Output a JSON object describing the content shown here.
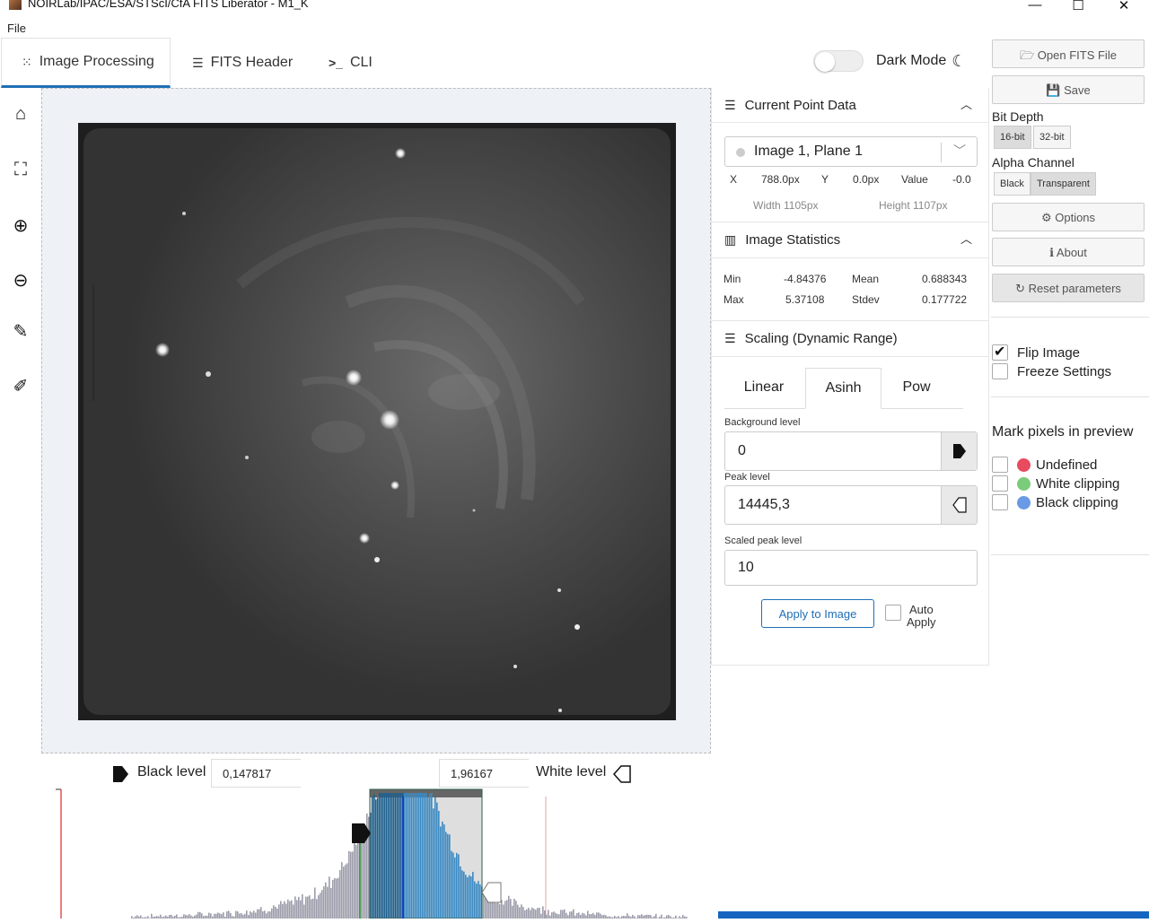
{
  "window": {
    "title": "NOIRLab/IPAC/ESA/STScI/CfA FITS Liberator - M1_K",
    "minimize": "—",
    "maximize": "☐",
    "close": "✕"
  },
  "menu": {
    "file": "File"
  },
  "tabs": [
    {
      "label": "Image Processing",
      "icon": "spinner-icon",
      "glyph": "⁙"
    },
    {
      "label": "FITS Header",
      "icon": "list-icon",
      "glyph": "☰"
    },
    {
      "label": "CLI",
      "icon": "terminal-icon",
      "glyph": ">_"
    }
  ],
  "dark_mode": {
    "label": "Dark Mode",
    "enabled": false,
    "glyph": "☾"
  },
  "tools": [
    {
      "name": "home-icon",
      "glyph": "⌂"
    },
    {
      "name": "fit-screen-icon",
      "glyph": "⛶"
    },
    {
      "name": "zoom-in-icon",
      "glyph": "⊕"
    },
    {
      "name": "zoom-out-icon",
      "glyph": "⊖"
    },
    {
      "name": "eyedropper-icon",
      "glyph": "✎"
    },
    {
      "name": "eyedropper-white-icon",
      "glyph": "✐"
    }
  ],
  "point_data": {
    "title": "Current Point Data",
    "image_select": "Image 1, Plane 1",
    "x_label": "X",
    "x_value": "788.0px",
    "y_label": "Y",
    "y_value": "0.0px",
    "value_label": "Value",
    "value_value": "-0.0",
    "width": "Width 1105px",
    "height": "Height 1107px"
  },
  "stats": {
    "title": "Image Statistics",
    "min_label": "Min",
    "min_value": "-4.84376",
    "mean_label": "Mean",
    "mean_value": "0.688343",
    "max_label": "Max",
    "max_value": "5.37108",
    "stdev_label": "Stdev",
    "stdev_value": "0.177722"
  },
  "scaling": {
    "title": "Scaling (Dynamic Range)",
    "tabs": [
      "Linear",
      "Asinh",
      "Pow"
    ],
    "active_tab": "Asinh",
    "background_label": "Background level",
    "background_value": "0",
    "peak_label": "Peak level",
    "peak_value": "14445,3",
    "scaled_peak_label": "Scaled peak level",
    "scaled_peak_value": "10",
    "apply_label": "Apply to Image",
    "auto_apply_label_1": "Auto",
    "auto_apply_label_2": "Apply"
  },
  "levels": {
    "black_label": "Black level",
    "black_value": "0,147817",
    "white_label": "White level",
    "white_value": "1,96167"
  },
  "sidebar": {
    "open_label": "Open FITS File",
    "save_label": "Save",
    "bit_depth_label": "Bit Depth",
    "bit_16": "16-bit",
    "bit_32": "32-bit",
    "bit_selected": "16-bit",
    "alpha_label": "Alpha Channel",
    "alpha_black": "Black",
    "alpha_transparent": "Transparent",
    "alpha_selected": "Transparent",
    "options_label": "Options",
    "about_label": "About",
    "reset_label": "Reset parameters",
    "flip_label": "Flip Image",
    "flip_checked": true,
    "freeze_label": "Freeze Settings",
    "freeze_checked": false,
    "mark_title": "Mark pixels in preview",
    "undefined_label": "Undefined",
    "undefined_color": "#e84a5f",
    "white_clip_label": "White clipping",
    "white_clip_color": "#7acb7a",
    "black_clip_label": "Black clipping",
    "black_clip_color": "#6a9ae6"
  },
  "colors": {
    "accent": "#1f6fb5",
    "histogram_selected": "#1c5f8e",
    "histogram_bg": "#9c9cab"
  }
}
